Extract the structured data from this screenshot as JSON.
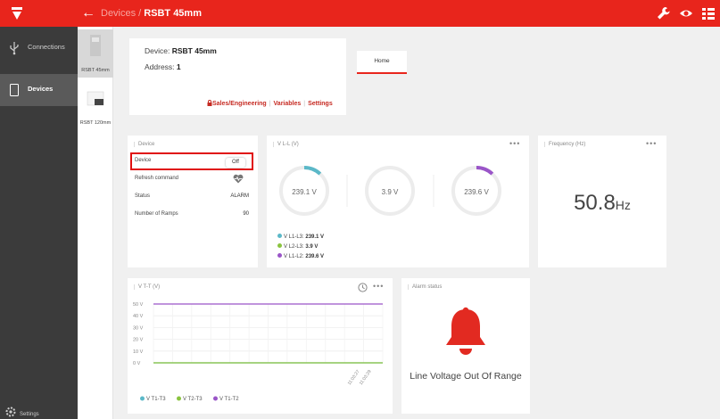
{
  "topbar": {
    "back_icon": "←",
    "breadcrumb": {
      "parent": "Devices",
      "separator": "/",
      "current": "RSBT 45mm"
    },
    "icons": [
      "wrench-icon",
      "eye-icon",
      "grid-menu-icon"
    ],
    "brand_color": "#e8251c"
  },
  "sidebar": {
    "items": [
      {
        "label": "Connections",
        "icon": "usb-icon"
      },
      {
        "label": "Devices",
        "icon": "device-icon",
        "active": true
      }
    ],
    "settings_label": "Settings"
  },
  "devices": [
    {
      "label": "RSBT 45mm",
      "active": true
    },
    {
      "label": "RSBT 120mm"
    }
  ],
  "device_info": {
    "name_label": "Device: ",
    "name": "RSBT 45mm",
    "address_label": "Address: ",
    "address": "1",
    "links": [
      "Sales/Engineering",
      "Variables",
      "Settings"
    ],
    "tab": "Home"
  },
  "device_card": {
    "title": "Device",
    "rows": [
      {
        "key": "Device",
        "value": "Off"
      },
      {
        "key": "Refresh command",
        "value": ""
      },
      {
        "key": "Status",
        "value": "ALARM"
      },
      {
        "key": "Number of Ramps",
        "value": "90"
      }
    ]
  },
  "vll_card": {
    "title": "V L-L (V)",
    "menu": "•••",
    "gauges": [
      {
        "value": "239.1 V",
        "fill": 0.12
      },
      {
        "value": "3.9 V",
        "fill": 0.0
      },
      {
        "value": "239.6 V",
        "fill": 0.12
      }
    ],
    "legend": [
      {
        "label": "V L1-L3: ",
        "value": "239.1 V",
        "color": "#5bb8c8"
      },
      {
        "label": "V L2-L3: ",
        "value": "3.9 V",
        "color": "#8ac43f"
      },
      {
        "label": "V L1-L2: ",
        "value": "239.6 V",
        "color": "#9a55c8"
      }
    ]
  },
  "freq_card": {
    "title": "Frequency (Hz)",
    "menu": "•••",
    "value": "50.8",
    "unit": "Hz"
  },
  "vtt_card": {
    "title": "V T-T (V)",
    "menu": "•••"
  },
  "alarm_card": {
    "title": "Alarm status",
    "message": "Line Voltage Out Of Range",
    "bell_color": "#e22a21"
  },
  "chart_data": {
    "type": "line",
    "title": "V T-T (V)",
    "x": [
      "11:03:27",
      "11:03:29"
    ],
    "ytick_labels": [
      "0 V",
      "10 V",
      "20 V",
      "30 V",
      "40 V",
      "50 V"
    ],
    "ylim": [
      0,
      50
    ],
    "grid": true,
    "series": [
      {
        "name": "V T1-T3",
        "color": "#5bb8c8",
        "values": [
          0,
          0
        ]
      },
      {
        "name": "V T2-T3",
        "color": "#8ac43f",
        "values": [
          0,
          0
        ]
      },
      {
        "name": "V T1-T2",
        "color": "#9a55c8",
        "values": [
          50,
          50
        ]
      }
    ]
  }
}
